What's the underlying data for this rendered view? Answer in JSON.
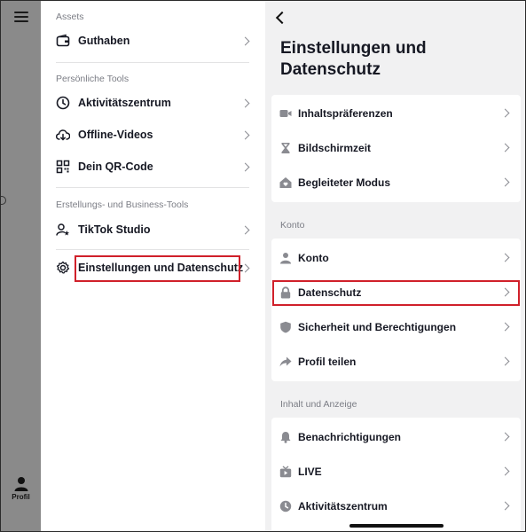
{
  "drawer": {
    "sections": [
      {
        "title": "Assets",
        "items": [
          {
            "label": "Guthaben",
            "icon": "wallet-icon"
          }
        ]
      },
      {
        "title": "Persönliche Tools",
        "items": [
          {
            "label": "Aktivitätszentrum",
            "icon": "clock-icon"
          },
          {
            "label": "Offline-Videos",
            "icon": "cloud-download-icon"
          },
          {
            "label": "Dein QR-Code",
            "icon": "qr-code-icon"
          }
        ]
      },
      {
        "title": "Erstellungs- und Business-Tools",
        "items": [
          {
            "label": "TikTok Studio",
            "icon": "user-star-icon"
          }
        ]
      }
    ],
    "settings_item": {
      "label": "Einstellungen und Datenschutz",
      "icon": "gear-icon"
    }
  },
  "bottom_tab": {
    "label": "Profil",
    "icon": "person-icon"
  },
  "settings": {
    "title": "Einstellungen und Datenschutz",
    "groups": [
      {
        "title": "",
        "items": [
          {
            "label": "Inhaltspräferenzen",
            "icon": "video-camera-icon"
          },
          {
            "label": "Bildschirmzeit",
            "icon": "hourglass-icon"
          },
          {
            "label": "Begleiteter Modus",
            "icon": "house-heart-icon"
          }
        ]
      },
      {
        "title": "Konto",
        "items": [
          {
            "label": "Konto",
            "icon": "person-icon"
          },
          {
            "label": "Datenschutz",
            "icon": "lock-icon"
          },
          {
            "label": "Sicherheit und Berechtigungen",
            "icon": "shield-icon"
          },
          {
            "label": "Profil teilen",
            "icon": "share-arrow-icon"
          }
        ]
      },
      {
        "title": "Inhalt und Anzeige",
        "items": [
          {
            "label": "Benachrichtigungen",
            "icon": "bell-icon"
          },
          {
            "label": "LIVE",
            "icon": "tv-icon"
          },
          {
            "label": "Aktivitätszentrum",
            "icon": "clock-icon"
          }
        ]
      }
    ]
  },
  "colors": {
    "highlight": "#d0202a",
    "panel_bg": "#f1f1f2",
    "text": "#161823",
    "muted": "#7b7d85"
  }
}
